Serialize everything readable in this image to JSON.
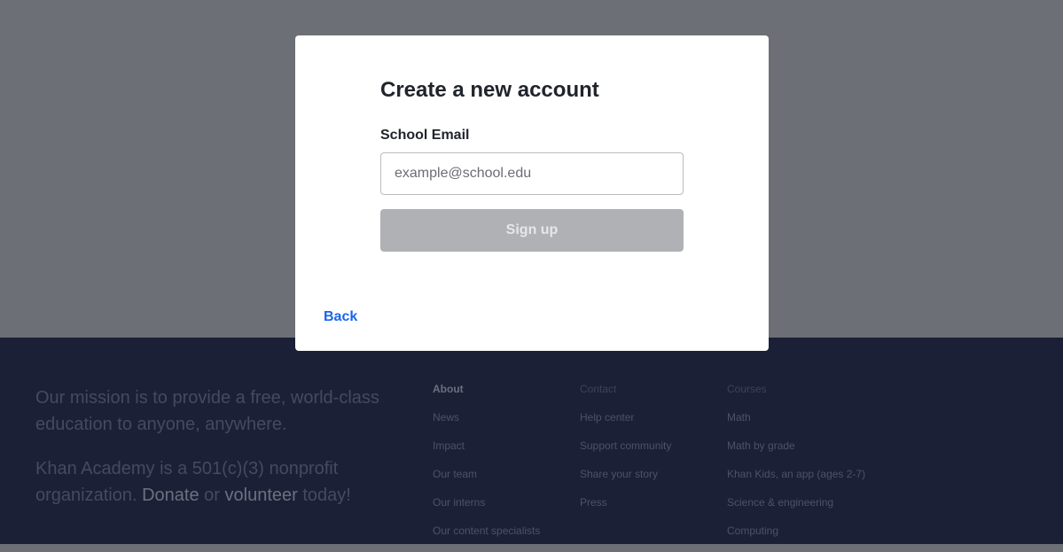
{
  "modal": {
    "title": "Create a new account",
    "email_label": "School Email",
    "email_placeholder": "example@school.edu",
    "email_value": "",
    "signup_label": "Sign up",
    "back_label": "Back"
  },
  "footer": {
    "mission_line": "Our mission is to provide a free, world-class education to anyone, anywhere.",
    "nonprofit_prefix": "Khan Academy is a 501(c)(3) nonprofit organization.",
    "donate_label": "Donate",
    "or_text": "or",
    "volunteer_label": "volunteer",
    "today_text": "today!",
    "columns": [
      {
        "heading": "About",
        "items": [
          "News",
          "Impact",
          "Our team",
          "Our interns",
          "Our content specialists"
        ]
      },
      {
        "heading": "Contact",
        "items": [
          "Help center",
          "Support community",
          "Share your story",
          "Press"
        ]
      },
      {
        "heading": "Courses",
        "items": [
          "Math",
          "Math by grade",
          "Khan Kids, an app (ages 2-7)",
          "Science & engineering",
          "Computing"
        ]
      }
    ]
  },
  "colors": {
    "overlay": "#6d6f76",
    "footer_bg": "#1b2036",
    "link_blue": "#1865f2",
    "disabled_button": "#b0b1b5"
  }
}
